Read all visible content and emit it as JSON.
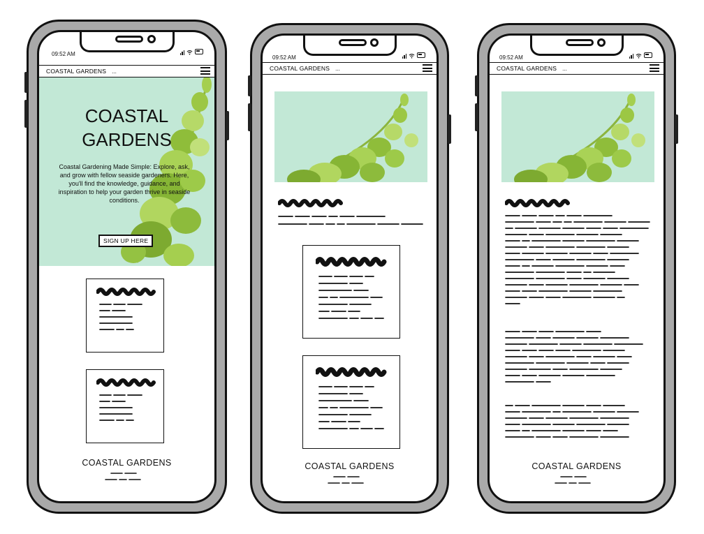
{
  "status_bar": {
    "time": "09:52 AM"
  },
  "nav": {
    "brand": "COASTAL GARDENS",
    "ellipsis": "..."
  },
  "hero": {
    "title_line1": "COASTAL",
    "title_line2": "GARDENS",
    "description": "Coastal Gardening Made Simple: Explore, ask, and grow with fellow seaside gardeners. Here, you'll find the knowledge, guidance, and inspiration to help your garden thrive in seaside conditions.",
    "cta_label": "SIGN UP HERE"
  },
  "footer": {
    "title": "COASTAL GARDENS"
  },
  "colors": {
    "hero_bg": "#c2e8d6",
    "leaf_light": "#b6d968",
    "leaf_dark": "#6e9e2c",
    "frame": "#a9a9a9"
  },
  "icons": [
    "signal-icon",
    "wifi-icon",
    "battery-icon",
    "hamburger-menu-icon"
  ]
}
